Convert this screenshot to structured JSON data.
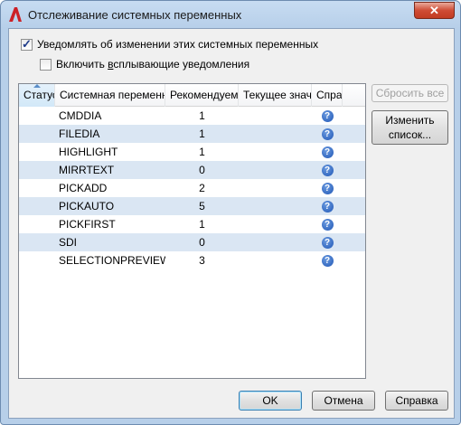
{
  "window": {
    "title": "Отслеживание системных переменных",
    "close_glyph": "✕"
  },
  "options": {
    "notify_label": "Уведомлять об изменении этих системных переменных",
    "notify_checked": true,
    "balloon_label_pre": "Включить ",
    "balloon_label_u": "в",
    "balloon_label_post": "сплывающие уведомления",
    "balloon_checked": false
  },
  "table": {
    "columns": [
      "Статус",
      "Системная переменная",
      "Рекомендуемое",
      "Текущее значение",
      "Справка"
    ],
    "rows": [
      {
        "name": "CMDDIA",
        "recommended": "1"
      },
      {
        "name": "FILEDIA",
        "recommended": "1"
      },
      {
        "name": "HIGHLIGHT",
        "recommended": "1"
      },
      {
        "name": "MIRRTEXT",
        "recommended": "0"
      },
      {
        "name": "PICKADD",
        "recommended": "2"
      },
      {
        "name": "PICKAUTO",
        "recommended": "5"
      },
      {
        "name": "PICKFIRST",
        "recommended": "1"
      },
      {
        "name": "SDI",
        "recommended": "0"
      },
      {
        "name": "SELECTIONPREVIEW",
        "recommended": "3"
      }
    ],
    "help_glyph": "?"
  },
  "side_buttons": {
    "reset_all": "Сбросить все",
    "edit_list_line1": "Изменить",
    "edit_list_line2": "список..."
  },
  "footer": {
    "ok": "OK",
    "cancel": "Отмена",
    "help": "Справка"
  },
  "colors": {
    "alt_row": "#dae6f3",
    "title_gradient": "#c7dcf2",
    "close_red": "#c23c22",
    "help_icon": "#1f56b5"
  }
}
